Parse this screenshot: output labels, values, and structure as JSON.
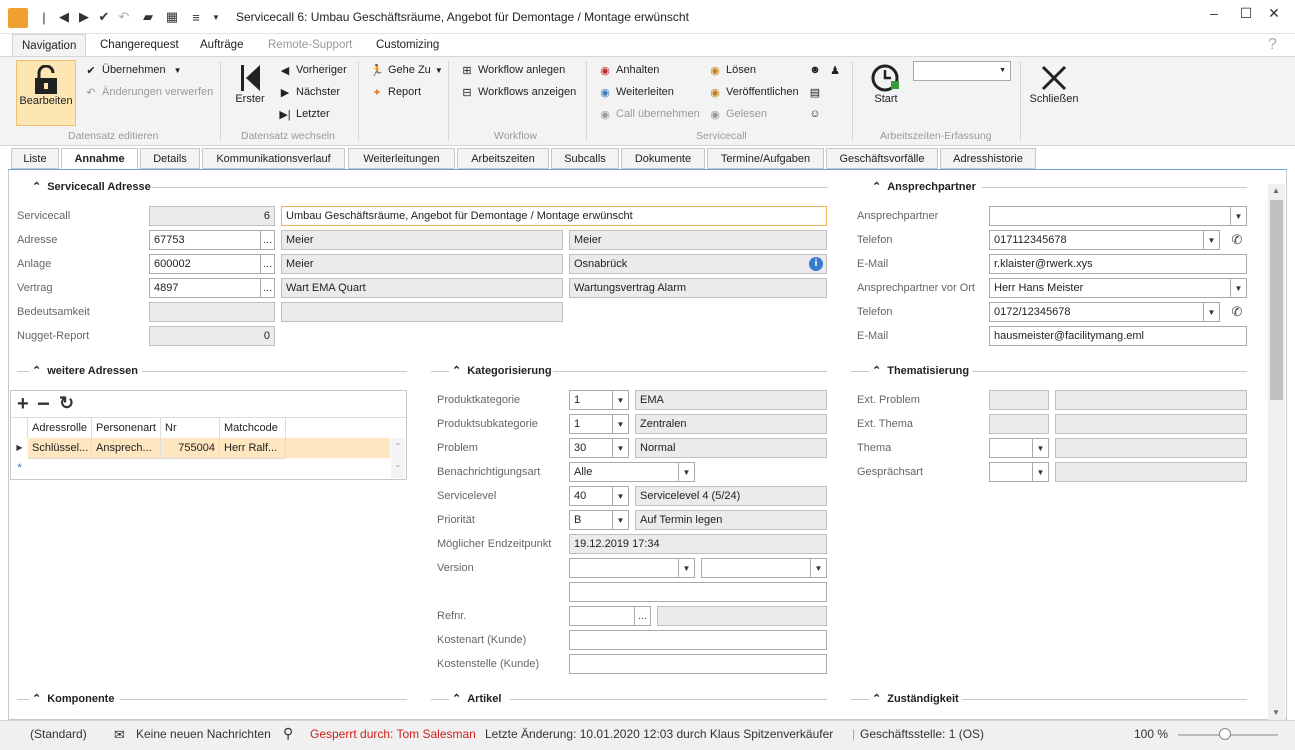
{
  "window": {
    "title": "Servicecall 6: Umbau Geschäftsräume, Angebot für Demontage / Montage erwünscht"
  },
  "ribbon_tabs": [
    "Navigation",
    "Changerequest",
    "Aufträge",
    "Remote-Support",
    "Customizing"
  ],
  "ribbon": {
    "bearbeiten": "Bearbeiten",
    "uebernehmen": "Übernehmen",
    "aenderungen_verwerfen": "Änderungen verwerfen",
    "group_datensatz_editieren": "Datensatz editieren",
    "erster": "Erster",
    "vorheriger": "Vorheriger",
    "naechster": "Nächster",
    "letzter": "Letzter",
    "group_datensatz_wechseln": "Datensatz wechseln",
    "gehe_zu": "Gehe Zu",
    "report": "Report",
    "workflow_anlegen": "Workflow anlegen",
    "workflows_anzeigen": "Workflows anzeigen",
    "group_workflow": "Workflow",
    "anhalten": "Anhalten",
    "weiterleiten": "Weiterleiten",
    "call_uebernehmen": "Call übernehmen",
    "loesen": "Lösen",
    "veroeffentlichen": "Veröffentlichen",
    "gelesen": "Gelesen",
    "group_servicecall": "Servicecall",
    "start": "Start",
    "group_arbeitszeiten": "Arbeitszeiten-Erfassung",
    "schliessen": "Schließen"
  },
  "tabs": [
    "Liste",
    "Annahme",
    "Details",
    "Kommunikationsverlauf",
    "Weiterleitungen",
    "Arbeitszeiten",
    "Subcalls",
    "Dokumente",
    "Termine/Aufgaben",
    "Geschäftsvorfälle",
    "Adresshistorie"
  ],
  "servicecall_adresse": {
    "title": "Servicecall Adresse",
    "servicecall_label": "Servicecall",
    "servicecall_nr": "6",
    "servicecall_text": "Umbau Geschäftsräume, Angebot für Demontage / Montage erwünscht",
    "adresse_label": "Adresse",
    "adresse_nr": "67753",
    "adresse_name1": "Meier",
    "adresse_name2": "Meier",
    "anlage_label": "Anlage",
    "anlage_nr": "600002",
    "anlage_name": "Meier",
    "anlage_ort": "Osnabrück",
    "vertrag_label": "Vertrag",
    "vertrag_nr": "4897",
    "vertrag_name": "Wart EMA Quart",
    "vertrag_typ": "Wartungsvertrag Alarm",
    "bedeutsamkeit_label": "Bedeutsamkeit",
    "nugget_label": "Nugget-Report",
    "nugget_value": "0"
  },
  "ansprechpartner": {
    "title": "Ansprechpartner",
    "ap_label": "Ansprechpartner",
    "ap_value": "",
    "tel_label": "Telefon",
    "tel_value": "017112345678",
    "email_label": "E-Mail",
    "email_value": "r.klaister@rwerk.xys",
    "ap_ort_label": "Ansprechpartner vor Ort",
    "ap_ort_value": "Herr Hans Meister",
    "tel2_label": "Telefon",
    "tel2_value": "0172/12345678",
    "email2_label": "E-Mail",
    "email2_value": "hausmeister@facilitymang.eml"
  },
  "weitere_adressen": {
    "title": "weitere Adressen",
    "columns": [
      "Adressrolle",
      "Personenart",
      "Nr",
      "Matchcode"
    ],
    "rows": [
      [
        "Schlüssel...",
        "Ansprech...",
        "755004",
        "Herr Ralf..."
      ]
    ]
  },
  "kategorisierung": {
    "title": "Kategorisierung",
    "produktkategorie_label": "Produktkategorie",
    "produktkategorie_code": "1",
    "produktkategorie_text": "EMA",
    "produktsubkategorie_label": "Produktsubkategorie",
    "produktsubkategorie_code": "1",
    "produktsubkategorie_text": "Zentralen",
    "problem_label": "Problem",
    "problem_code": "30",
    "problem_text": "Normal",
    "benachrichtigungsart_label": "Benachrichtigungsart",
    "benachrichtigungsart_value": "Alle",
    "servicelevel_label": "Servicelevel",
    "servicelevel_code": "40",
    "servicelevel_text": "Servicelevel 4 (5/24)",
    "prioritaet_label": "Priorität",
    "prioritaet_code": "B",
    "prioritaet_text": "Auf Termin legen",
    "endzeitpunkt_label": "Möglicher Endzeitpunkt",
    "endzeitpunkt_value": "19.12.2019 17:34",
    "version_label": "Version",
    "refnr_label": "Refnr.",
    "kostenart_label": "Kostenart (Kunde)",
    "kostenstelle_label": "Kostenstelle (Kunde)"
  },
  "thematisierung": {
    "title": "Thematisierung",
    "ext_problem_label": "Ext. Problem",
    "ext_thema_label": "Ext. Thema",
    "thema_label": "Thema",
    "gespraechsart_label": "Gesprächsart"
  },
  "lower_sections": {
    "komponente": "Komponente",
    "artikel": "Artikel",
    "zustaendigkeit": "Zuständigkeit"
  },
  "status": {
    "standard": "(Standard)",
    "nachrichten": "Keine neuen Nachrichten",
    "gesperrt": "Gesperrt durch: Tom Salesman",
    "letzte_aenderung": "Letzte Änderung: 10.01.2020 12:03 durch Klaus Spitzenverkäufer",
    "geschaeftsstelle": "Geschäftsstelle:  1 (OS)",
    "zoom": "100 %"
  },
  "colors": {
    "accent": "#f0a030",
    "locked": "#d02020",
    "tab_border": "#6fa0d8",
    "highlight": "#fde6b3"
  }
}
